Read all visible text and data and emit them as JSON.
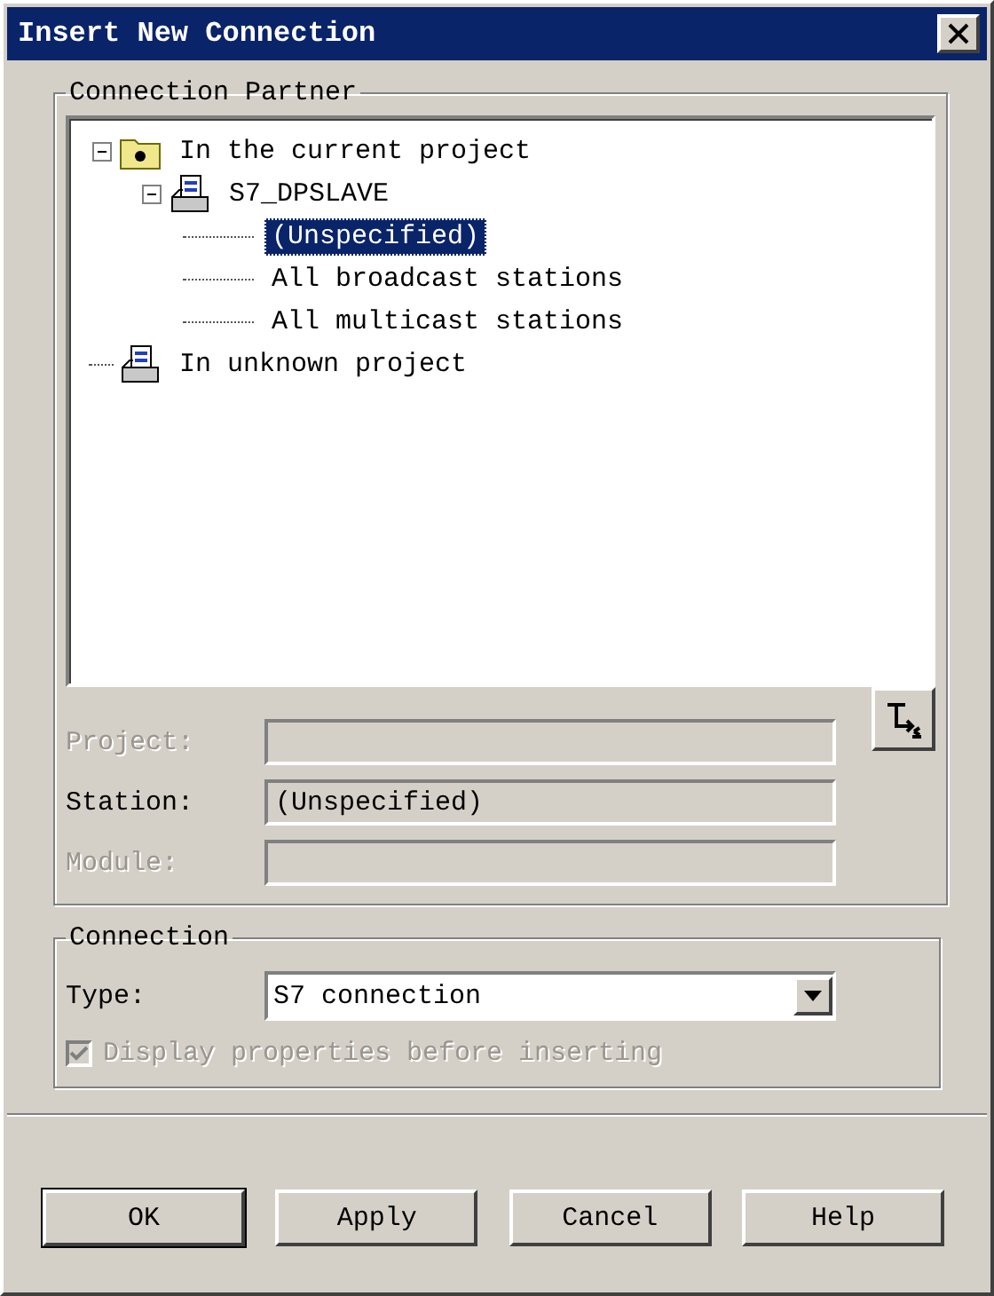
{
  "window": {
    "title": "Insert New Connection"
  },
  "partner": {
    "legend": "Connection Partner",
    "tree": [
      {
        "label": "In the current project",
        "kind": "folder",
        "expanded": true,
        "selected": false,
        "children": [
          {
            "label": "S7_DPSLAVE",
            "kind": "station",
            "expanded": true,
            "selected": false,
            "children": [
              {
                "label": "(Unspecified)",
                "kind": "leaf",
                "selected": true
              },
              {
                "label": "All broadcast stations",
                "kind": "leaf",
                "selected": false
              },
              {
                "label": "All multicast stations",
                "kind": "leaf",
                "selected": false
              }
            ]
          }
        ]
      },
      {
        "label": "In unknown project",
        "kind": "station",
        "selected": false
      }
    ],
    "fields": [
      {
        "label": "Project:",
        "disabled": true
      },
      {
        "label": "Station:",
        "disabled": false,
        "value": "(Unspecified)"
      },
      {
        "label": "Module:",
        "disabled": true
      }
    ]
  },
  "connection": {
    "legend": "Connection",
    "type_label": "Type:",
    "type_value": "S7 connection",
    "checkbox": {
      "label": "Display properties before inserting",
      "checked": true,
      "disabled": true
    }
  },
  "buttons": [
    {
      "label": "OK",
      "default": true
    },
    {
      "label": "Apply",
      "default": false
    },
    {
      "label": "Cancel",
      "default": false
    },
    {
      "label": "Help",
      "default": false
    }
  ]
}
